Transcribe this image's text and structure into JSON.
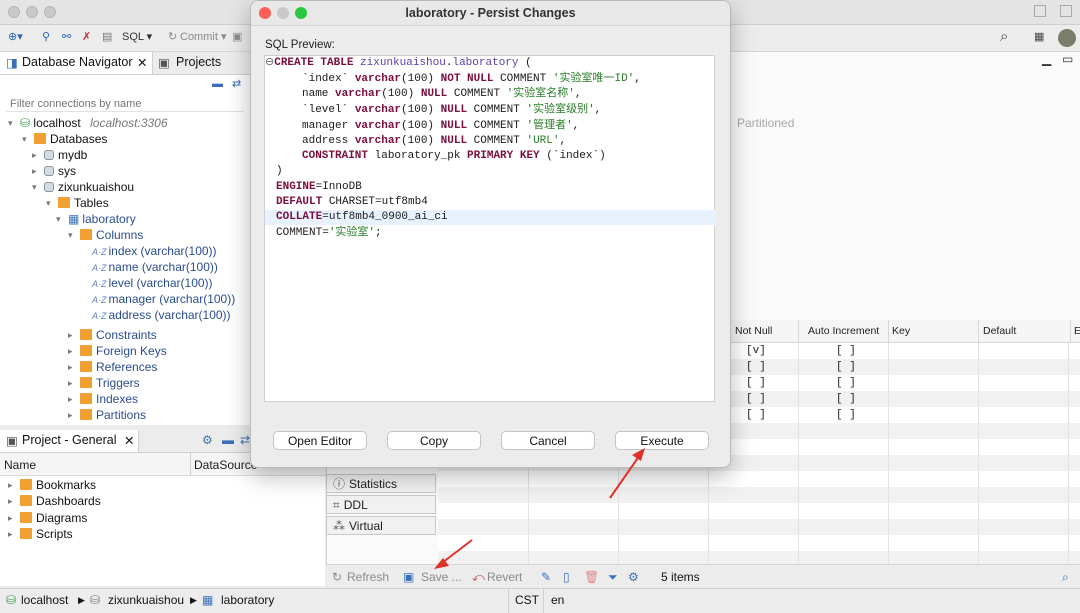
{
  "toolbar": {
    "sql_label": "SQL ▾",
    "commit_label": "Commit ▾"
  },
  "nav": {
    "tab_navigator": "Database Navigator",
    "tab_projects": "Projects",
    "filter_placeholder": "Filter connections by name",
    "tree": [
      {
        "label": "localhost",
        "sub": "localhost:3306"
      },
      {
        "label": "Databases"
      },
      {
        "label": "mydb"
      },
      {
        "label": "sys"
      },
      {
        "label": "zixunkuaishou"
      },
      {
        "label": "Tables"
      },
      {
        "label": "laboratory"
      },
      {
        "label": "Columns"
      },
      {
        "label": "index (varchar(100))"
      },
      {
        "label": "name (varchar(100))"
      },
      {
        "label": "level (varchar(100))"
      },
      {
        "label": "manager (varchar(100))"
      },
      {
        "label": "address (varchar(100))"
      },
      {
        "label": "Constraints"
      },
      {
        "label": "Foreign Keys"
      },
      {
        "label": "References"
      },
      {
        "label": "Triggers"
      },
      {
        "label": "Indexes"
      },
      {
        "label": "Partitions"
      }
    ]
  },
  "project": {
    "tab": "Project - General",
    "col_name": "Name",
    "col_datasource": "DataSource",
    "items": [
      "Bookmarks",
      "Dashboards",
      "Diagrams",
      "Scripts"
    ]
  },
  "right": {
    "partitioned": "Partitioned",
    "columns": [
      "Not Null",
      "Auto Increment",
      "Key",
      "Default",
      "E"
    ],
    "not_null": [
      "[v]",
      "[ ]",
      "[ ]",
      "[ ]",
      "[ ]"
    ],
    "auto_inc": [
      "[ ]",
      "[ ]",
      "[ ]",
      "[ ]",
      "[ ]"
    ]
  },
  "lower_tabs": [
    "Statistics",
    "DDL",
    "Virtual"
  ],
  "bottom": {
    "refresh": "Refresh",
    "save": "Save ...",
    "revert": "Revert",
    "count": "5 items"
  },
  "status": {
    "crumbs": [
      "localhost",
      "zixunkuaishou",
      "laboratory"
    ],
    "tz": "CST",
    "lang": "en"
  },
  "dialog": {
    "title": "laboratory - Persist Changes",
    "sql_label": "SQL Preview:",
    "buttons": {
      "open_editor": "Open Editor",
      "copy": "Copy",
      "cancel": "Cancel",
      "execute": "Execute"
    }
  },
  "accent_color": "#e0302b"
}
